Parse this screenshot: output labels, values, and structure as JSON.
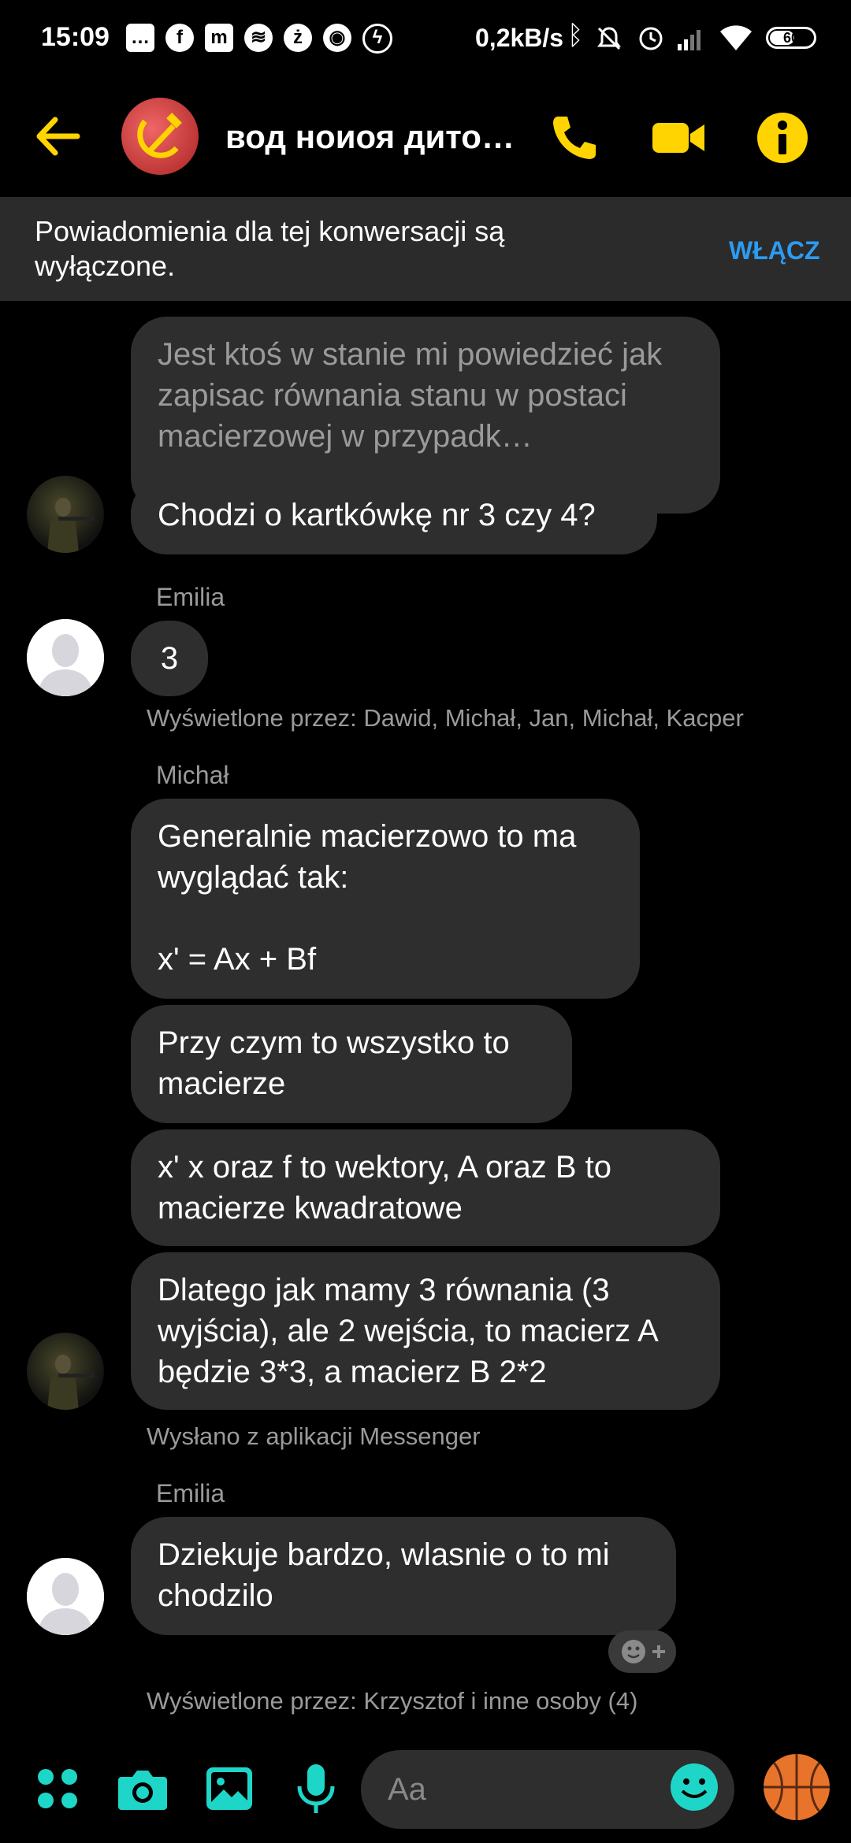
{
  "status_bar": {
    "time": "15:09",
    "speed": "0,2kB/s",
    "battery": "60",
    "battery_level": 0.6,
    "left_icons": [
      "message-icon",
      "facebook-icon",
      "m-icon",
      "spotify-icon",
      "z-icon",
      "chrome-icon",
      "messenger-icon"
    ],
    "right_icons": [
      "bluetooth-icon",
      "mute-icon",
      "alarm-icon",
      "signal-icon",
      "wifi-icon"
    ]
  },
  "header": {
    "title": "вод ноиоя дито…",
    "accent": "#FFD400",
    "icons": [
      "back-arrow-icon",
      "phone-icon",
      "video-icon",
      "info-icon"
    ]
  },
  "banner": {
    "text": "Powiadomienia dla tej konwersacji są wyłączone.",
    "button": "WŁĄCZ"
  },
  "messages": {
    "m1": "Jest ktoś w stanie mi powiedzieć jak zapisac równania stanu w postaci macierzowej w przypadk…",
    "m2": "Chodzi o kartkówkę nr 3 czy 4?",
    "emilia_label_1": "Emilia",
    "m3": "3",
    "seen_1": "Wyświetlone przez: Dawid, Michał, Jan, Michał, Kacper",
    "michal_label": "Michał",
    "m4": "Generalnie macierzowo to ma wyglądać tak:\n\nx' = Ax + Bf",
    "m5": "Przy czym to wszystko to macierze",
    "m6": "x' x oraz f to wektory, A oraz B to macierze kwadratowe",
    "m7": "Dlatego jak mamy 3 równania (3 wyjścia), ale 2 wejścia, to macierz A będzie 3*3, a macierz B 2*2",
    "sent_from": "Wysłano z aplikacji Messenger",
    "emilia_label_2": "Emilia",
    "m8": "Dziekuje bardzo, wlasnie o to mi chodzilo",
    "seen_2": "Wyświetlone przez: Krzysztof i inne osoby (4)"
  },
  "composer": {
    "placeholder": "Aa",
    "accent": "#1ED6C8",
    "icons": [
      "apps-icon",
      "camera-icon",
      "gallery-icon",
      "microphone-icon",
      "emoji-icon",
      "basketball-icon"
    ]
  }
}
